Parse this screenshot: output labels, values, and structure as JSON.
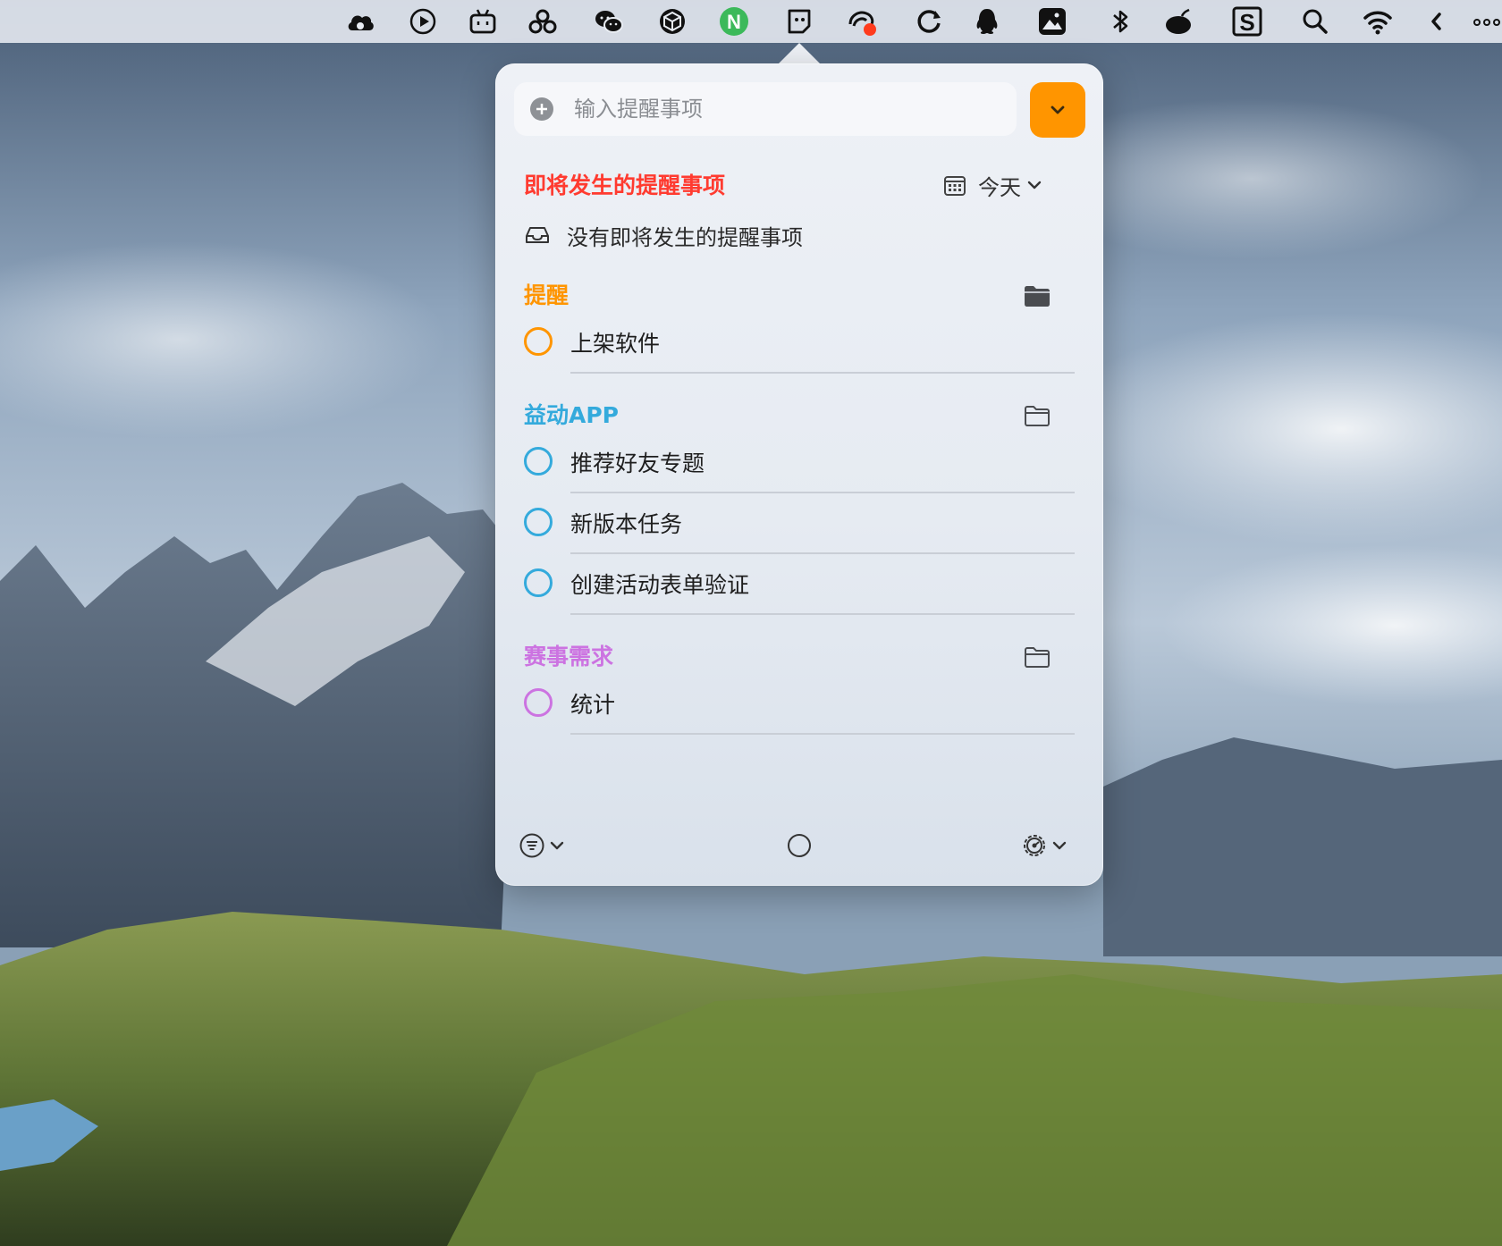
{
  "menubar": {
    "icons": [
      "cloud-icon",
      "play-icon",
      "tv-icon",
      "group-icon",
      "wechat-icon",
      "box-icon",
      "n-app-icon",
      "notes-icon",
      "bird-icon",
      "sync-icon",
      "qq-icon",
      "photo-icon",
      "bluetooth-icon",
      "bomb-icon",
      "s-app-icon",
      "search-icon",
      "wifi-icon",
      "chevron-left-icon",
      "more-icon"
    ],
    "n_app_letter": "N",
    "s_app_letter": "S"
  },
  "input": {
    "placeholder": "输入提醒事项"
  },
  "upcoming": {
    "title": "即将发生的提醒事项",
    "title_color": "#ff3b30",
    "filter_label": "今天",
    "empty_text": "没有即将发生的提醒事项"
  },
  "lists": [
    {
      "name": "提醒",
      "color": "#ff9500",
      "tasks": [
        "上架软件"
      ]
    },
    {
      "name": "益动APP",
      "color": "#34aadc",
      "tasks": [
        "推荐好友专题",
        "新版本任务",
        "创建活动表单验证"
      ]
    },
    {
      "name": "赛事需求",
      "color": "#cc73e1",
      "tasks": [
        "统计"
      ]
    }
  ],
  "colors": {
    "accent": "#ff9500"
  }
}
